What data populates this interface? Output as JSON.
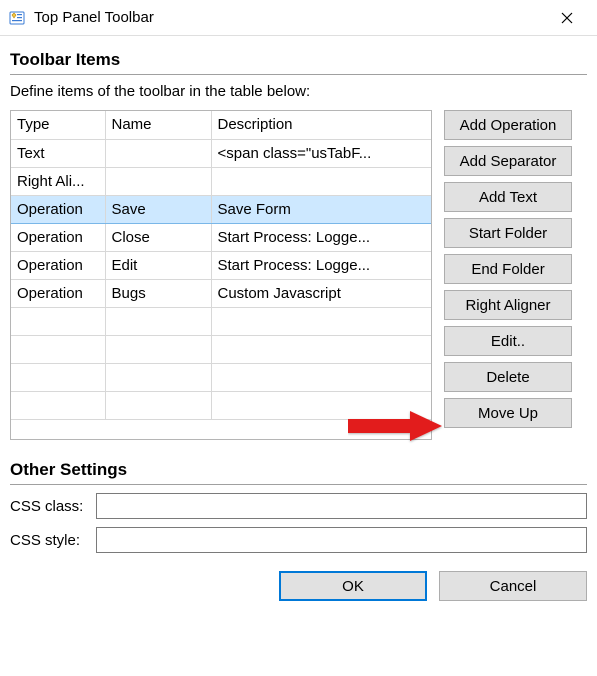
{
  "window": {
    "title": "Top Panel Toolbar",
    "icon": "toolbar-icon"
  },
  "section_toolbar": {
    "heading": "Toolbar Items",
    "subtext": "Define items of the toolbar in the table below:"
  },
  "table": {
    "columns": [
      "Type",
      "Name",
      "Description"
    ],
    "rows": [
      {
        "type": "Text",
        "name": "",
        "description": "<span class=\"usTabF...",
        "selected": false
      },
      {
        "type": "Right Ali...",
        "name": "",
        "description": "",
        "selected": false
      },
      {
        "type": "Operation",
        "name": "Save",
        "description": "Save Form",
        "selected": true
      },
      {
        "type": "Operation",
        "name": "Close",
        "description": "Start Process: Logge...",
        "selected": false
      },
      {
        "type": "Operation",
        "name": "Edit",
        "description": "Start Process: Logge...",
        "selected": false
      },
      {
        "type": "Operation",
        "name": "Bugs",
        "description": "Custom Javascript",
        "selected": false
      },
      {
        "empty": true
      },
      {
        "empty": true
      },
      {
        "empty": true
      },
      {
        "empty": true
      }
    ]
  },
  "buttons": {
    "add_operation": "Add Operation",
    "add_separator": "Add Separator",
    "add_text": "Add Text",
    "start_folder": "Start Folder",
    "end_folder": "End Folder",
    "right_aligner": "Right Aligner",
    "edit": "Edit..",
    "delete": "Delete",
    "move_up": "Move Up"
  },
  "section_other": {
    "heading": "Other Settings",
    "css_class_label": "CSS class:",
    "css_class_value": "",
    "css_style_label": "CSS style:",
    "css_style_value": ""
  },
  "dialog": {
    "ok": "OK",
    "cancel": "Cancel"
  }
}
